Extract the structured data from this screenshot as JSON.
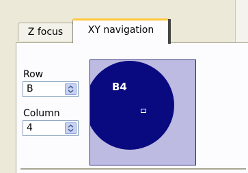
{
  "tabs": [
    {
      "label": "Z focus",
      "active": false
    },
    {
      "label": "XY navigation",
      "active": true
    }
  ],
  "row": {
    "label": "Row",
    "value": "B"
  },
  "column": {
    "label": "Column",
    "value": "4"
  },
  "navigator": {
    "well_label": "B4",
    "colors": {
      "background": "#bdbbe1",
      "well": "#0a0a80",
      "marker": "#ffffff"
    }
  }
}
